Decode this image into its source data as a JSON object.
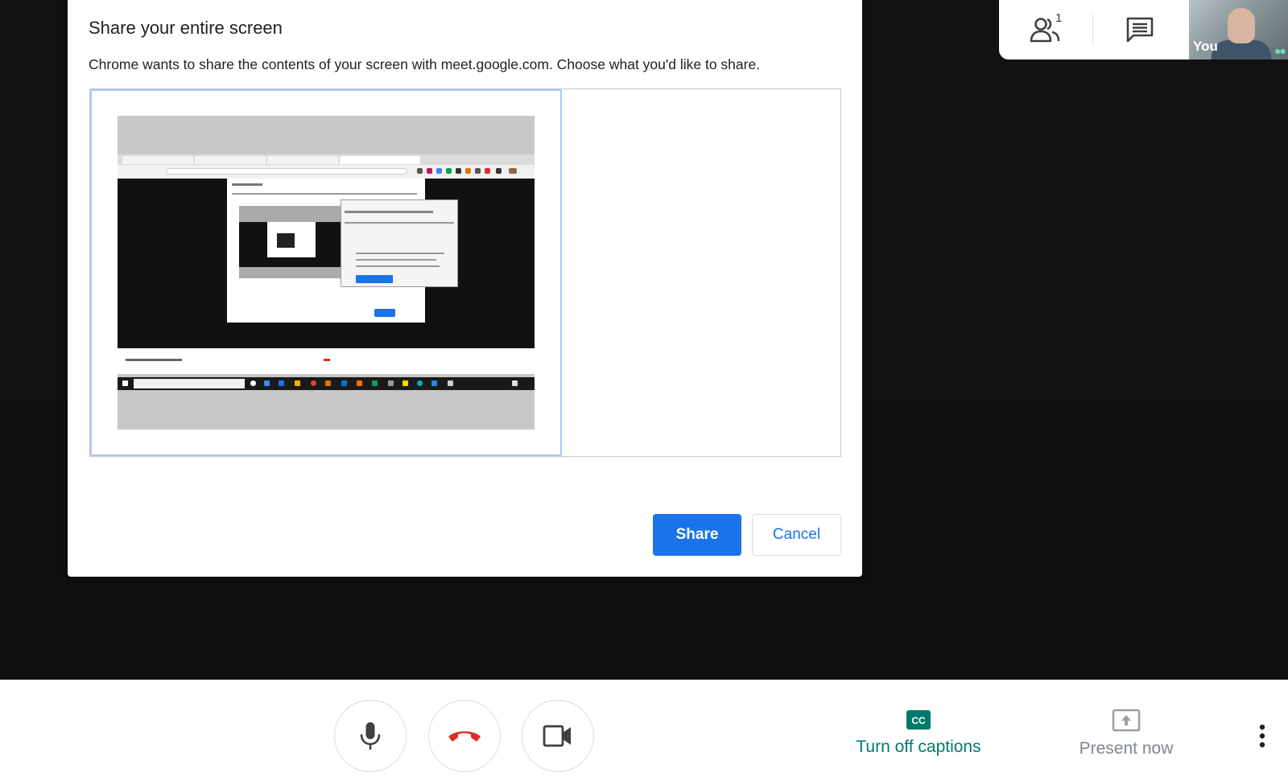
{
  "dialog": {
    "title": "Share your entire screen",
    "description": "Chrome wants to share the contents of your screen with meet.google.com. Choose what you'd like to share.",
    "share_label": "Share",
    "cancel_label": "Cancel"
  },
  "top_panel": {
    "participant_count": "1",
    "people_icon": "people-icon",
    "chat_icon": "chat-icon",
    "self_label": "You"
  },
  "controls": {
    "mic_icon": "microphone-icon",
    "hangup_icon": "hang-up-icon",
    "camera_icon": "camera-icon",
    "captions_label": "Turn off captions",
    "captions_icon": "closed-captions-icon",
    "present_label": "Present now",
    "present_icon": "present-screen-icon",
    "more_icon": "more-options-icon"
  },
  "colors": {
    "primary": "#1a73e8",
    "captions": "#00796b",
    "hangup": "#d93025",
    "disabled": "#80868b",
    "background": "#121212"
  }
}
